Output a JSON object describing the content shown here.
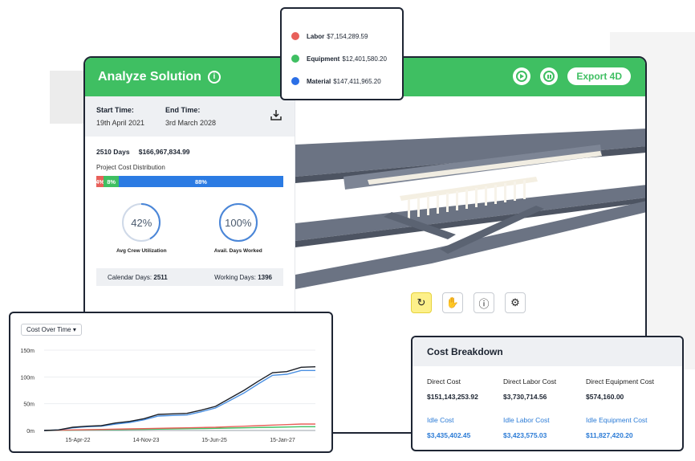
{
  "header": {
    "title": "Analyze Solution",
    "info_glyph": "i",
    "export_label": "Export 4D"
  },
  "side": {
    "start_label": "Start Time:",
    "start_value": "19th April 2021",
    "end_label": "End Time:",
    "end_value": "3rd March 2028",
    "days": "2510 Days",
    "total_cost": "$166,967,834.99",
    "distribution_label": "Project Cost Distribution",
    "distribution": [
      {
        "label": "4%",
        "value": 4,
        "color": "#e8605a"
      },
      {
        "label": "8%",
        "value": 8,
        "color": "#3fbf62"
      },
      {
        "label": "88%",
        "value": 88,
        "color": "#2b7be3"
      }
    ],
    "gauges": [
      {
        "value": "42%",
        "fraction": 0.42,
        "label": "Avg Crew Utilization"
      },
      {
        "value": "100%",
        "fraction": 1.0,
        "label": "Avail. Days Worked"
      }
    ],
    "calendar_label": "Calendar Days:",
    "calendar_value": "2511",
    "working_label": "Working Days:",
    "working_value": "1396"
  },
  "legend": [
    {
      "name": "Labor",
      "value": "$7,154,289.59",
      "color": "#e8605a"
    },
    {
      "name": "Equipment",
      "value": "$12,401,580.20",
      "color": "#3fbf62"
    },
    {
      "name": "Material",
      "value": "$147,411,965.20",
      "color": "#2b6fe6"
    }
  ],
  "toolbar": {
    "icons": [
      "redo-icon",
      "hand-icon",
      "info-icon",
      "settings-icon"
    ]
  },
  "chart_select": "Cost Over Time",
  "chart_data": {
    "type": "line",
    "title": "",
    "xlabel": "",
    "ylabel": "",
    "y_ticks": [
      "150m",
      "100m",
      "50m",
      "0m"
    ],
    "x_ticks": [
      "15-Apr-22",
      "14-Nov-23",
      "15-Jun-25",
      "15-Jan-27"
    ],
    "ylim": [
      0,
      150
    ],
    "x_index": [
      0,
      1,
      2,
      3,
      4,
      5,
      6,
      7,
      8,
      9,
      10,
      11,
      12,
      13,
      14,
      15,
      16,
      17,
      18,
      19
    ],
    "series": [
      {
        "color": "#1b1f27",
        "values": [
          0,
          1,
          6,
          8,
          9,
          14,
          17,
          22,
          30,
          31,
          32,
          38,
          45,
          60,
          75,
          92,
          108,
          110,
          118,
          119
        ]
      },
      {
        "color": "#4a90e2",
        "values": [
          0,
          1,
          5,
          7,
          8,
          12,
          15,
          20,
          27,
          28,
          29,
          35,
          42,
          56,
          70,
          87,
          103,
          105,
          112,
          112
        ]
      },
      {
        "color": "#e8605a",
        "values": [
          0,
          0.5,
          1,
          1.5,
          2,
          2.5,
          3,
          3.5,
          4,
          4.5,
          5,
          5.5,
          6,
          7,
          8,
          9,
          10,
          11,
          12,
          12
        ]
      },
      {
        "color": "#3fbf62",
        "values": [
          0,
          0.3,
          0.6,
          1,
          1.3,
          1.6,
          2,
          2.3,
          2.6,
          3,
          3.3,
          3.6,
          4,
          4.5,
          5,
          5.5,
          6,
          6.5,
          7,
          7
        ]
      }
    ]
  },
  "cost": {
    "title": "Cost Breakdown",
    "items": [
      {
        "label": "Direct Cost",
        "value": "$151,143,253.92",
        "blue": false
      },
      {
        "label": "Direct Labor Cost",
        "value": "$3,730,714.56",
        "blue": false
      },
      {
        "label": "Direct Equipment Cost",
        "value": "$574,160.00",
        "blue": false
      },
      {
        "label": "Idle Cost",
        "value": "$3,435,402.45",
        "blue": true
      },
      {
        "label": "Idle Labor Cost",
        "value": "$3,423,575.03",
        "blue": true
      },
      {
        "label": "Idle Equipment Cost",
        "value": "$11,827,420.20",
        "blue": true
      }
    ]
  }
}
